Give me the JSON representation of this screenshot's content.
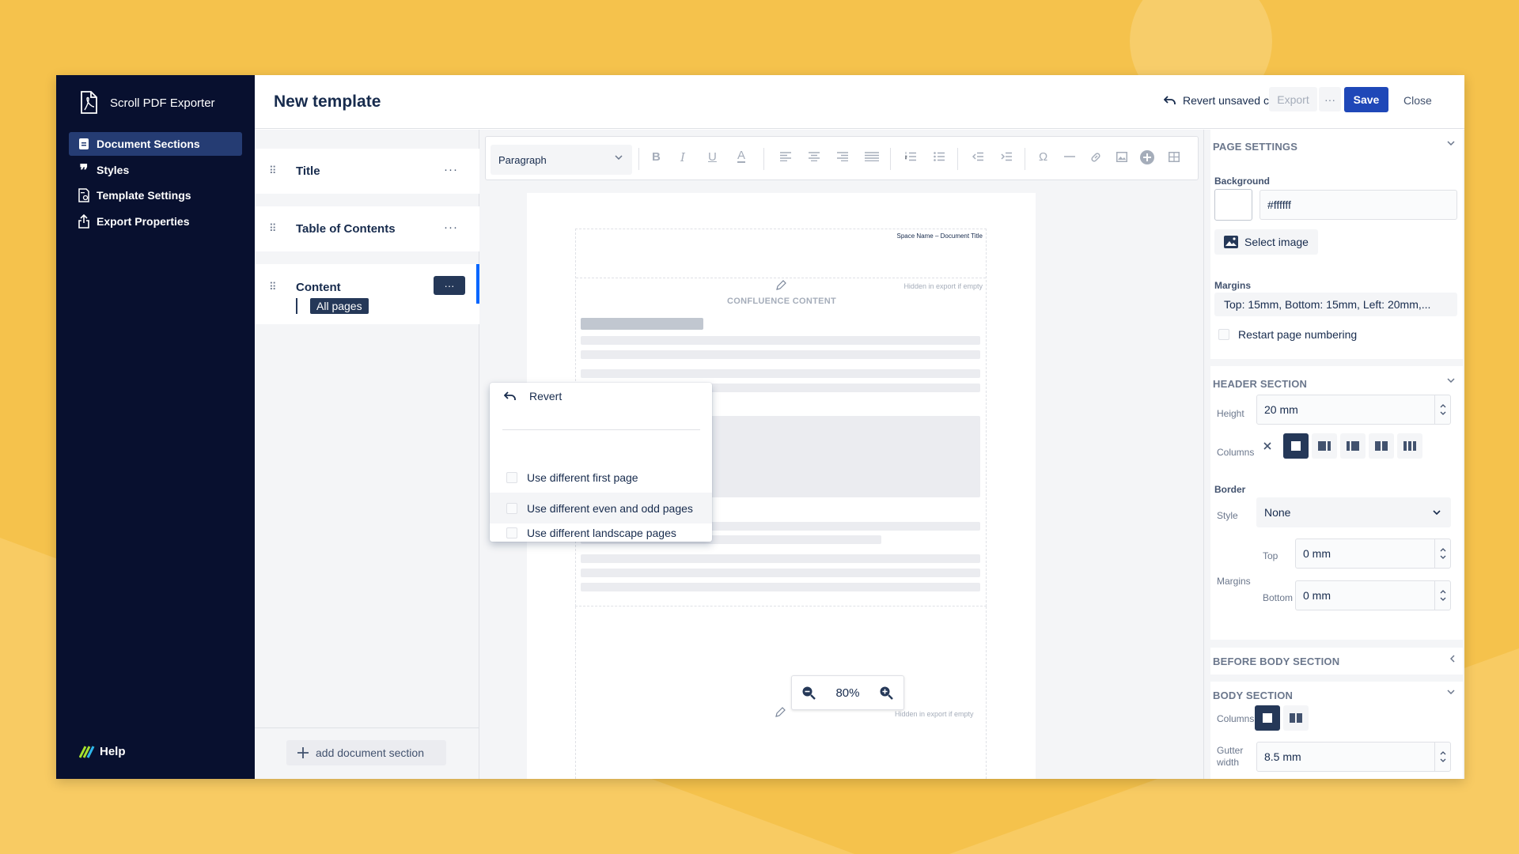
{
  "app": {
    "name": "Scroll PDF Exporter",
    "help_label": "Help"
  },
  "sidebar": {
    "items": [
      {
        "label": "Document Sections",
        "icon": "document-icon",
        "active": true
      },
      {
        "label": "Styles",
        "icon": "quote-icon",
        "active": false
      },
      {
        "label": "Template Settings",
        "icon": "template-settings-icon",
        "active": false
      },
      {
        "label": "Export Properties",
        "icon": "export-icon",
        "active": false
      }
    ]
  },
  "topbar": {
    "title": "New template",
    "revert_label": "Revert unsaved changes",
    "export_label": "Export",
    "more_label": "···",
    "save_label": "Save",
    "close_label": "Close"
  },
  "sections": {
    "items": [
      {
        "label": "Title",
        "more": "···"
      },
      {
        "label": "Table of Contents",
        "more": "···"
      },
      {
        "label": "Content",
        "more": "···",
        "badge": "All pages",
        "selected": true
      }
    ],
    "grip": "⠿",
    "add_label": "add document section"
  },
  "context_menu": {
    "revert_label": "Revert",
    "options": [
      {
        "label": "Use different first page",
        "checked": false
      },
      {
        "label": "Use different even and odd pages",
        "checked": false,
        "hovered": true
      },
      {
        "label": "Use different landscape pages",
        "checked": false
      }
    ]
  },
  "editor": {
    "paragraph_style": "Paragraph",
    "header_text": "Space Name  –  Document Title",
    "hidden_hint": "Hidden in export if empty",
    "content_label": "CONFLUENCE CONTENT",
    "zoom_value": "80%"
  },
  "page_settings": {
    "heading": "PAGE SETTINGS",
    "background_label": "Background",
    "background_value": "#ffffff",
    "select_image_label": "Select image",
    "margins_label": "Margins",
    "margins_value": "Top: 15mm, Bottom: 15mm, Left: 20mm,...",
    "restart_numbering_label": "Restart page numbering"
  },
  "header_section": {
    "heading": "HEADER SECTION",
    "height_label": "Height",
    "height_value": "20 mm",
    "columns_label": "Columns",
    "border_label": "Border",
    "style_label": "Style",
    "style_value": "None",
    "margins_label": "Margins",
    "top_label": "Top",
    "top_value": "0 mm",
    "bottom_label": "Bottom",
    "bottom_value": "0 mm"
  },
  "before_body_section": {
    "heading": "BEFORE BODY SECTION"
  },
  "body_section": {
    "heading": "BODY SECTION",
    "columns_label": "Columns",
    "gutter_label": "Gutter\nwidth",
    "gutter_value": "8.5 mm"
  },
  "colors": {
    "accent": "#1f48b8",
    "sidebar": "#08102f",
    "background": "#f5c24c"
  }
}
